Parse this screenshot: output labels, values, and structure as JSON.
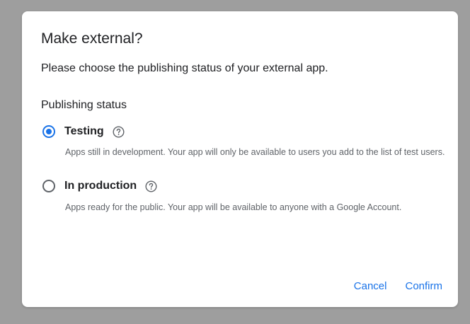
{
  "dialog": {
    "title": "Make external?",
    "subtitle": "Please choose the publishing status of your external app.",
    "section_label": "Publishing status",
    "options": [
      {
        "label": "Testing",
        "description": "Apps still in development. Your app will only be available to users you add to the list of test users.",
        "selected": true,
        "icon": "help-icon"
      },
      {
        "label": "In production",
        "description": "Apps ready for the public. Your app will be available to anyone with a Google Account.",
        "selected": false,
        "icon": "help-icon"
      }
    ],
    "actions": {
      "cancel_label": "Cancel",
      "confirm_label": "Confirm"
    }
  },
  "colors": {
    "accent": "#1a73e8",
    "text": "#202124",
    "secondary_text": "#5f6368",
    "backdrop": "#9e9e9e"
  }
}
